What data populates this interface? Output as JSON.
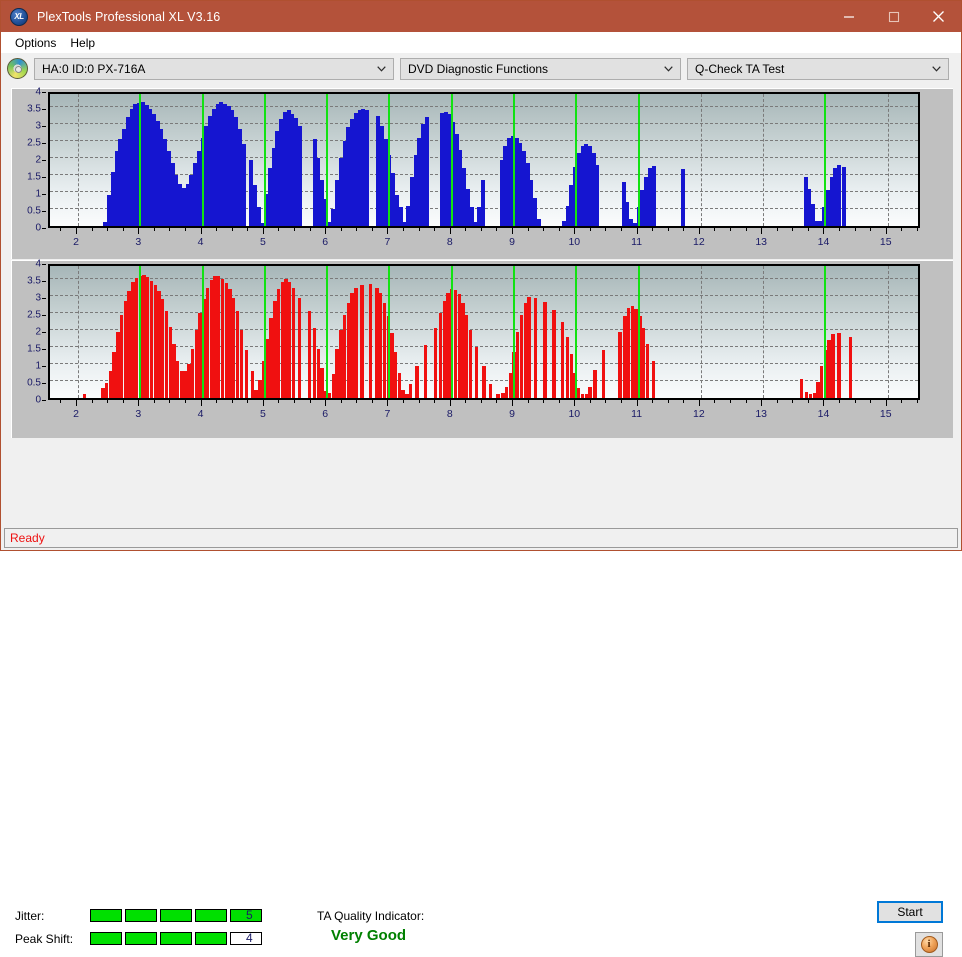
{
  "window": {
    "title": "PlexTools Professional XL V3.16",
    "app_icon": "plextools-xl-icon",
    "minimize": "minimize-icon",
    "maximize": "maximize-icon",
    "close": "close-icon",
    "accent_color": "#b4523a"
  },
  "menu": {
    "items": [
      {
        "label": "Options"
      },
      {
        "label": "Help"
      }
    ]
  },
  "toolbar": {
    "drive_icon": "disc-drive-icon",
    "drive_select": "HA:0 ID:0  PX-716A",
    "function_select": "DVD Diagnostic Functions",
    "test_select": "Q-Check TA Test"
  },
  "footer": {
    "jitter_label": "Jitter:",
    "jitter_value": "5",
    "jitter_segments": 5,
    "jitter_total": 5,
    "peak_shift_label": "Peak Shift:",
    "peak_shift_value": "4",
    "peak_shift_segments": 4,
    "peak_shift_total": 5,
    "quality_label": "TA Quality Indicator:",
    "quality_value": "Very Good",
    "quality_color": "#008000",
    "start_label": "Start",
    "info_icon": "info-icon",
    "info_glyph": "i"
  },
  "statusbar": {
    "text": "Ready"
  },
  "chart_data": [
    {
      "type": "bar",
      "name": "jitter-chart",
      "title": "",
      "xlabel": "",
      "ylabel": "",
      "xlim": [
        1.55,
        15.55
      ],
      "ylim": [
        0,
        4
      ],
      "ytick_labels": [
        "0",
        "0.5",
        "1",
        "1.5",
        "2",
        "2.5",
        "3",
        "3.5",
        "4"
      ],
      "yticks": [
        0,
        0.5,
        1,
        1.5,
        2,
        2.5,
        3,
        3.5,
        4
      ],
      "xtick_labels": [
        "2",
        "3",
        "4",
        "5",
        "6",
        "7",
        "8",
        "9",
        "10",
        "11",
        "12",
        "13",
        "14",
        "15"
      ],
      "xticks": [
        2,
        3,
        4,
        5,
        6,
        7,
        8,
        9,
        10,
        11,
        12,
        13,
        14,
        15
      ],
      "grid": true,
      "bar_color": "#1515d0",
      "marker_color": "#12e212",
      "markers": [
        3,
        4,
        5,
        6,
        7,
        8,
        9,
        10,
        11,
        14
      ],
      "x": [
        2.44,
        2.5,
        2.56,
        2.62,
        2.68,
        2.74,
        2.8,
        2.86,
        2.92,
        2.98,
        3.04,
        3.1,
        3.16,
        3.22,
        3.28,
        3.34,
        3.4,
        3.46,
        3.52,
        3.58,
        3.64,
        3.7,
        3.76,
        3.82,
        3.88,
        3.94,
        4.0,
        4.06,
        4.12,
        4.18,
        4.24,
        4.3,
        4.36,
        4.42,
        4.48,
        4.54,
        4.6,
        4.66,
        4.78,
        4.84,
        4.9,
        4.96,
        5.02,
        5.08,
        5.14,
        5.2,
        5.26,
        5.32,
        5.38,
        5.44,
        5.5,
        5.56,
        5.8,
        5.86,
        5.92,
        5.98,
        6.04,
        6.1,
        6.16,
        6.22,
        6.28,
        6.34,
        6.4,
        6.46,
        6.52,
        6.58,
        6.64,
        6.82,
        6.88,
        6.94,
        7.0,
        7.06,
        7.12,
        7.18,
        7.24,
        7.3,
        7.36,
        7.42,
        7.48,
        7.54,
        7.6,
        7.84,
        7.9,
        7.96,
        8.02,
        8.08,
        8.14,
        8.2,
        8.26,
        8.32,
        8.38,
        8.44,
        8.5,
        8.8,
        8.86,
        8.92,
        8.98,
        9.04,
        9.1,
        9.16,
        9.22,
        9.28,
        9.34,
        9.4,
        9.8,
        9.86,
        9.92,
        9.98,
        10.04,
        10.1,
        10.16,
        10.22,
        10.28,
        10.34,
        10.76,
        10.82,
        10.88,
        10.94,
        11.0,
        11.06,
        11.12,
        11.18,
        11.24,
        11.72,
        13.68,
        13.74,
        13.8,
        13.86,
        13.92,
        13.98,
        14.04,
        14.1,
        14.16,
        14.22,
        14.3
      ],
      "values": [
        0.12,
        0.9,
        1.6,
        2.2,
        2.55,
        2.85,
        3.2,
        3.45,
        3.6,
        3.62,
        3.65,
        3.55,
        3.45,
        3.3,
        3.1,
        2.85,
        2.55,
        2.2,
        1.85,
        1.5,
        1.25,
        1.12,
        1.25,
        1.5,
        1.85,
        2.2,
        2.6,
        2.95,
        3.25,
        3.45,
        3.58,
        3.66,
        3.6,
        3.52,
        3.4,
        3.2,
        2.85,
        2.4,
        1.95,
        1.2,
        0.55,
        0.1,
        0.95,
        1.7,
        2.3,
        2.8,
        3.15,
        3.35,
        3.42,
        3.3,
        3.18,
        2.95,
        2.55,
        2.0,
        1.35,
        0.8,
        0.12,
        0.5,
        1.35,
        2.0,
        2.5,
        2.9,
        3.15,
        3.32,
        3.42,
        3.45,
        3.4,
        3.25,
        2.95,
        2.55,
        2.1,
        1.55,
        0.9,
        0.55,
        0.12,
        0.6,
        1.45,
        2.1,
        2.6,
        3.0,
        3.22,
        3.32,
        3.36,
        3.28,
        3.05,
        2.7,
        2.25,
        1.7,
        1.1,
        0.55,
        0.12,
        0.55,
        1.35,
        1.95,
        2.35,
        2.6,
        2.66,
        2.6,
        2.45,
        2.2,
        1.85,
        1.35,
        0.82,
        0.2,
        0.15,
        0.6,
        1.2,
        1.75,
        2.15,
        2.36,
        2.42,
        2.35,
        2.15,
        1.8,
        1.3,
        0.7,
        0.2,
        0.1,
        0.55,
        1.05,
        1.45,
        1.7,
        1.76,
        1.68,
        1.45,
        1.1,
        0.65,
        0.15,
        0.15,
        0.55,
        1.05,
        1.45,
        1.7,
        1.8,
        1.75,
        1.55,
        1.2,
        0.7,
        0.2
      ]
    },
    {
      "type": "bar",
      "name": "peak-shift-chart",
      "title": "",
      "xlabel": "",
      "ylabel": "",
      "xlim": [
        1.55,
        15.55
      ],
      "ylim": [
        0,
        4
      ],
      "ytick_labels": [
        "0",
        "0.5",
        "1",
        "1.5",
        "2",
        "2.5",
        "3",
        "3.5",
        "4"
      ],
      "yticks": [
        0,
        0.5,
        1,
        1.5,
        2,
        2.5,
        3,
        3.5,
        4
      ],
      "xtick_labels": [
        "2",
        "3",
        "4",
        "5",
        "6",
        "7",
        "8",
        "9",
        "10",
        "11",
        "12",
        "13",
        "14",
        "15"
      ],
      "xticks": [
        2,
        3,
        4,
        5,
        6,
        7,
        8,
        9,
        10,
        11,
        12,
        13,
        14,
        15
      ],
      "grid": true,
      "bar_color": "#f01010",
      "marker_color": "#12e212",
      "markers": [
        3,
        4,
        5,
        6,
        7,
        8,
        9,
        10,
        11,
        14
      ],
      "x": [
        2.1,
        2.4,
        2.46,
        2.52,
        2.58,
        2.64,
        2.7,
        2.76,
        2.82,
        2.88,
        2.94,
        3.0,
        3.06,
        3.12,
        3.18,
        3.24,
        3.3,
        3.36,
        3.42,
        3.48,
        3.54,
        3.6,
        3.66,
        3.72,
        3.78,
        3.84,
        3.9,
        3.96,
        4.02,
        4.08,
        4.14,
        4.2,
        4.26,
        4.32,
        4.38,
        4.44,
        4.5,
        4.56,
        4.62,
        4.7,
        4.8,
        4.86,
        4.92,
        4.98,
        5.04,
        5.1,
        5.16,
        5.22,
        5.28,
        5.34,
        5.4,
        5.46,
        5.56,
        5.72,
        5.8,
        5.86,
        5.92,
        5.98,
        6.04,
        6.1,
        6.16,
        6.22,
        6.28,
        6.34,
        6.4,
        6.46,
        6.56,
        6.7,
        6.8,
        6.86,
        6.92,
        6.98,
        7.04,
        7.1,
        7.16,
        7.22,
        7.28,
        7.34,
        7.44,
        7.58,
        7.74,
        7.82,
        7.88,
        7.94,
        8.0,
        8.06,
        8.12,
        8.18,
        8.24,
        8.3,
        8.4,
        8.52,
        8.62,
        8.74,
        8.82,
        8.88,
        8.94,
        9.0,
        9.06,
        9.12,
        9.18,
        9.24,
        9.34,
        9.5,
        9.64,
        9.78,
        9.86,
        9.92,
        9.98,
        10.04,
        10.1,
        10.16,
        10.22,
        10.3,
        10.44,
        10.7,
        10.78,
        10.84,
        10.9,
        10.96,
        11.02,
        11.08,
        11.14,
        11.24,
        13.62,
        13.7,
        13.76,
        13.82,
        13.88,
        13.94,
        14.0,
        14.06,
        14.12,
        14.22,
        14.4
      ],
      "values": [
        0.12,
        0.3,
        0.45,
        0.8,
        1.35,
        1.95,
        2.45,
        2.85,
        3.15,
        3.4,
        3.52,
        3.58,
        3.62,
        3.55,
        3.45,
        3.32,
        3.15,
        2.9,
        2.55,
        2.1,
        1.6,
        1.1,
        0.8,
        0.78,
        1.0,
        1.45,
        2.0,
        2.5,
        2.9,
        3.25,
        3.48,
        3.6,
        3.58,
        3.5,
        3.38,
        3.2,
        2.95,
        2.55,
        2.0,
        1.4,
        0.8,
        0.25,
        0.52,
        1.1,
        1.75,
        2.35,
        2.85,
        3.2,
        3.42,
        3.5,
        3.42,
        3.25,
        2.95,
        2.55,
        2.05,
        1.45,
        0.88,
        0.2,
        0.15,
        0.72,
        1.45,
        2.0,
        2.45,
        2.8,
        3.08,
        3.25,
        3.32,
        3.35,
        3.25,
        3.1,
        2.8,
        2.4,
        1.9,
        1.35,
        0.75,
        0.25,
        0.12,
        0.42,
        0.95,
        1.55,
        2.05,
        2.5,
        2.85,
        3.1,
        3.22,
        3.18,
        3.05,
        2.8,
        2.45,
        2.0,
        1.5,
        0.95,
        0.42,
        0.12,
        0.15,
        0.32,
        0.75,
        1.35,
        1.95,
        2.45,
        2.8,
        2.98,
        2.95,
        2.82,
        2.6,
        2.25,
        1.8,
        1.3,
        0.75,
        0.3,
        0.12,
        0.12,
        0.32,
        0.82,
        1.4,
        1.95,
        2.4,
        2.65,
        2.72,
        2.62,
        2.4,
        2.05,
        1.6,
        1.1,
        0.55,
        0.18,
        0.12,
        0.15,
        0.48,
        0.95,
        1.4,
        1.72,
        1.88,
        1.9,
        1.8,
        1.58,
        1.25,
        0.85,
        0.4,
        0.12,
        0.12
      ]
    }
  ]
}
